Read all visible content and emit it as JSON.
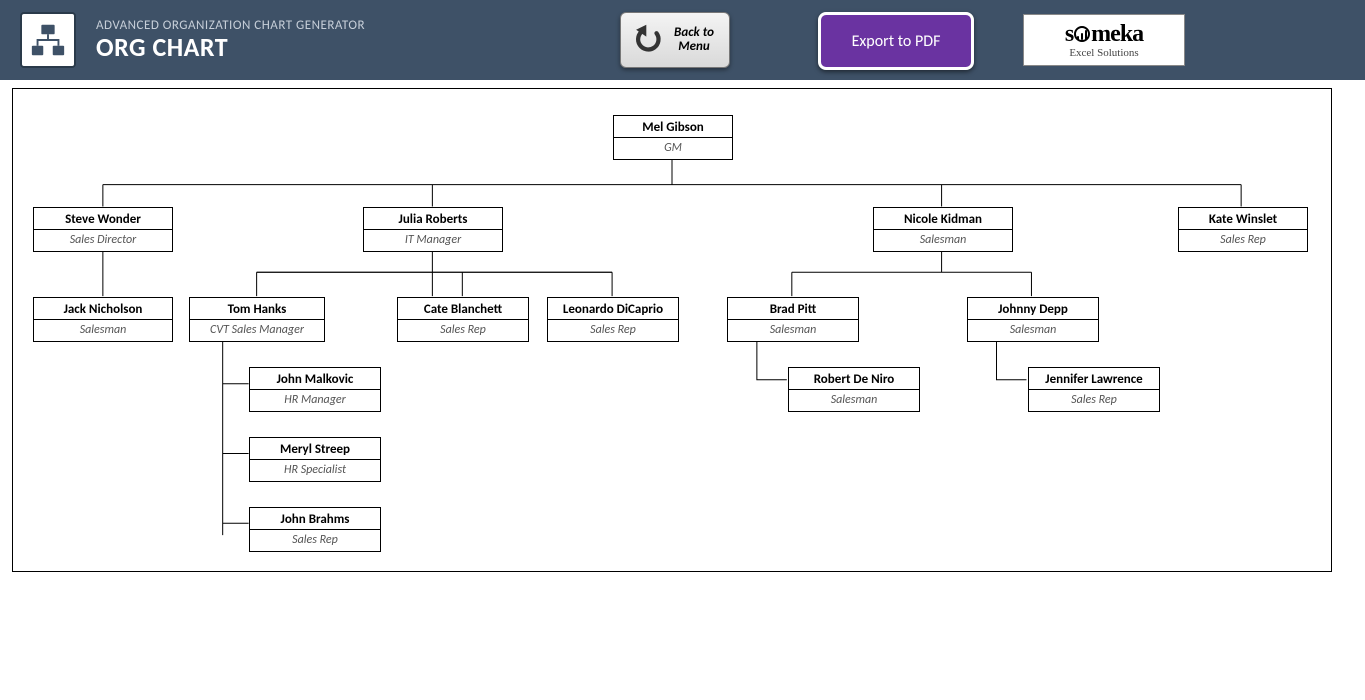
{
  "header": {
    "subtitle": "ADVANCED ORGANIZATION CHART GENERATOR",
    "title": "ORG CHART",
    "back_label": "Back to Menu",
    "export_label": "Export to PDF",
    "brand_name": "someka",
    "brand_sub": "Excel Solutions"
  },
  "chart_data": {
    "type": "org-chart",
    "nodes": {
      "root": {
        "name": "Mel Gibson",
        "role": "GM"
      },
      "l1a": {
        "name": "Steve Wonder",
        "role": "Sales Director"
      },
      "l1b": {
        "name": "Julia Roberts",
        "role": "IT Manager"
      },
      "l1c": {
        "name": "Nicole Kidman",
        "role": "Salesman"
      },
      "l1d": {
        "name": "Kate Winslet",
        "role": "Sales Rep"
      },
      "l2a": {
        "name": "Jack Nicholson",
        "role": "Salesman"
      },
      "l2b": {
        "name": "Tom Hanks",
        "role": "CVT Sales Manager"
      },
      "l2c": {
        "name": "Cate Blanchett",
        "role": "Sales Rep"
      },
      "l2d": {
        "name": "Leonardo DiCaprio",
        "role": "Sales Rep"
      },
      "l2e": {
        "name": "Brad Pitt",
        "role": "Salesman"
      },
      "l2f": {
        "name": "Johnny Depp",
        "role": "Salesman"
      },
      "l3a": {
        "name": "John Malkovic",
        "role": "HR Manager"
      },
      "l3b": {
        "name": "Meryl Streep",
        "role": "HR Specialist"
      },
      "l3c": {
        "name": "John Brahms",
        "role": "Sales Rep"
      },
      "l3d": {
        "name": "Robert De Niro",
        "role": "Salesman"
      },
      "l3e": {
        "name": "Jennifer Lawrence",
        "role": "Sales Rep"
      }
    },
    "edges": [
      [
        "root",
        "l1a"
      ],
      [
        "root",
        "l1b"
      ],
      [
        "root",
        "l1c"
      ],
      [
        "root",
        "l1d"
      ],
      [
        "l1a",
        "l2a"
      ],
      [
        "l1b",
        "l2b"
      ],
      [
        "l1b",
        "l2c"
      ],
      [
        "l1b",
        "l2d"
      ],
      [
        "l1c",
        "l2e"
      ],
      [
        "l1c",
        "l2f"
      ],
      [
        "l2b",
        "l3a"
      ],
      [
        "l2b",
        "l3b"
      ],
      [
        "l2b",
        "l3c"
      ],
      [
        "l2e",
        "l3d"
      ],
      [
        "l2f",
        "l3e"
      ]
    ]
  }
}
